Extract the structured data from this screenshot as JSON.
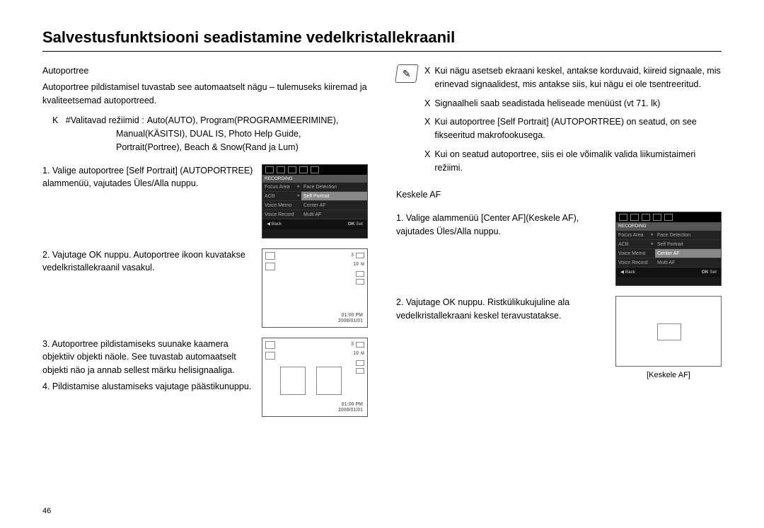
{
  "title": "Salvestusfunktsiooni seadistamine vedelkristallekraanil",
  "left": {
    "section_heading": "Autoportree",
    "intro": "Autoportree pildistamisel tuvastab see automaatselt nägu – tulemuseks kiiremad ja kvaliteetsemad autoportreed.",
    "modes_label": "K   #Valitavad režiimid :",
    "modes_line1": "Auto(AUTO), Program(PROGRAMMEERIMINE),",
    "modes_line2": "Manual(KÄSITSI), DUAL IS, Photo Help Guide,",
    "modes_line3": "Portrait(Portree), Beach & Snow(Rand ja Lum)",
    "step1": "1. Valige autoportree [Self Portrait] (AUTOPORTREE) alammenüü, vajutades Üles/Alla nuppu.",
    "step2": "2. Vajutage OK nuppu. Autoportree ikoon kuvatakse vedelkristallekraanil vasakul.",
    "step3": "3. Autoportree pildistamiseks suunake kaamera objektiiv objekti näole. See tuvastab automaatselt objekti näo ja annab sellest märku helisignaaliga.",
    "step4": "4. Pildistamise alustamiseks vajutage päästikunuppu.",
    "menu": {
      "header": "RECORDING",
      "left_items": [
        "Focus Area",
        "ACB",
        "Voice Memo",
        "Voice Record"
      ],
      "right_items": [
        "Face Detection",
        "Self Portrait",
        "Center AF",
        "Multi AF"
      ],
      "highlight_left": "Self Portrait",
      "back": "Back",
      "set": "Set",
      "ok": "OK"
    },
    "lcd": {
      "count": "3",
      "ten": "10",
      "time": "01:00 PM",
      "date": "2008/01/01"
    }
  },
  "right": {
    "note1": "Kui nägu asetseb ekraani keskel, antakse korduvaid, kiireid signaale, mis erinevad signaalidest, mis antakse siis, kui nägu ei ole tsentreeritud.",
    "note2": "Signaalheli saab seadistada heliseade menüüst (vt 71. lk)",
    "note3": "Kui autoportree [Self Portrait] (AUTOPORTREE) on seatud, on see fikseeritud makrofookusega.",
    "note4": "Kui on seatud autoportree, siis ei ole võimalik valida liikumistaimeri režiimi.",
    "note_bullet": "X",
    "section_heading": "Keskele AF",
    "step1": "1. Valige alammenüü [Center AF](Keskele AF), vajutades Üles/Alla nuppu.",
    "step2": "2. Vajutage OK nuppu. Ristkülikukujuline ala vedelkristallekraani keskel teravustatakse.",
    "caption": "[Keskele AF]",
    "menu": {
      "header": "RECORDING",
      "left_items": [
        "Focus Area",
        "ACB",
        "Voice Memo",
        "Voice Record"
      ],
      "right_items": [
        "Face Detection",
        "Self Portrait",
        "Center AF",
        "Multi AF"
      ],
      "highlight_right": "Center AF",
      "back": "Back",
      "set": "Set",
      "ok": "OK"
    }
  },
  "page_number": "46"
}
